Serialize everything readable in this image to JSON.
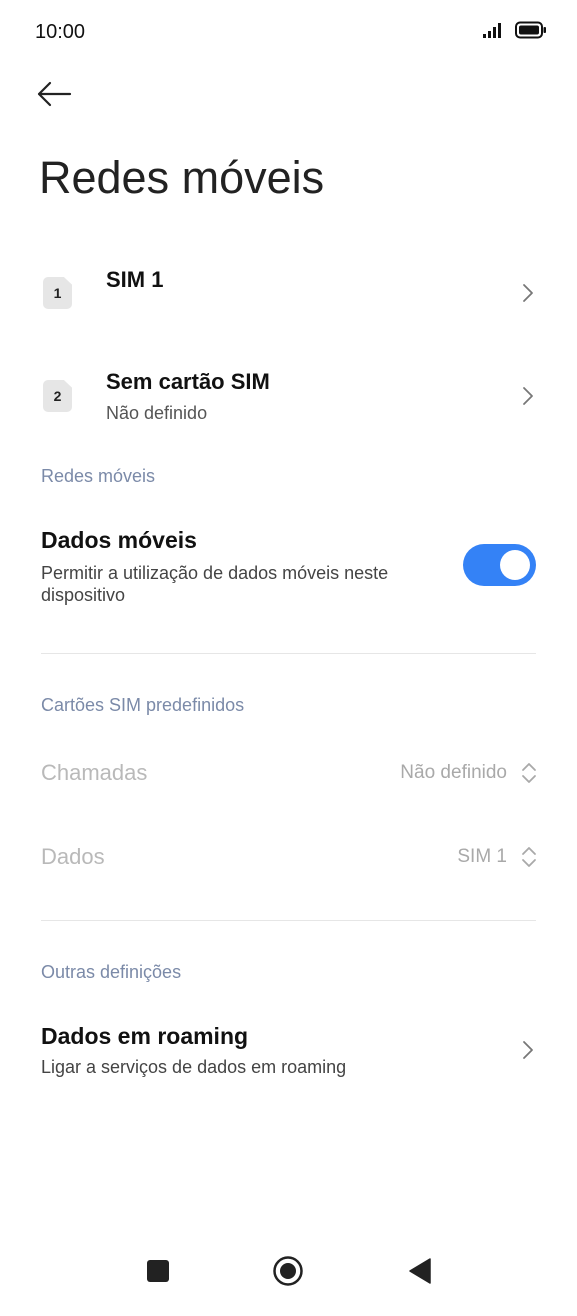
{
  "status_bar": {
    "time": "10:00",
    "icons": [
      "signal-icon",
      "battery-icon"
    ]
  },
  "header": {
    "back_icon": "back-arrow-icon",
    "title": "Redes móveis"
  },
  "sim_list": [
    {
      "badge": "1",
      "title": "SIM 1",
      "subtitle": ""
    },
    {
      "badge": "2",
      "title": "Sem cartão SIM",
      "subtitle": "Não definido"
    }
  ],
  "mobile_networks_section": {
    "header": "Redes móveis",
    "mobile_data": {
      "title": "Dados móveis",
      "description": "Permitir a utilização de dados móveis neste dispositivo",
      "enabled": true
    }
  },
  "default_sims_section": {
    "header": "Cartões SIM predefinidos",
    "calls": {
      "label": "Chamadas",
      "value": "Não definido"
    },
    "data": {
      "label": "Dados",
      "value": "SIM 1"
    }
  },
  "other_settings_section": {
    "header": "Outras definições",
    "roaming": {
      "title": "Dados em roaming",
      "description": "Ligar a serviços de dados em roaming"
    }
  },
  "nav_bar": {
    "icons": [
      "recents-square-icon",
      "home-circle-icon",
      "back-triangle-icon"
    ]
  },
  "colors": {
    "accent": "#3482f6",
    "section_header": "#7b8aa8",
    "disabled_text": "#b9b9b9"
  }
}
